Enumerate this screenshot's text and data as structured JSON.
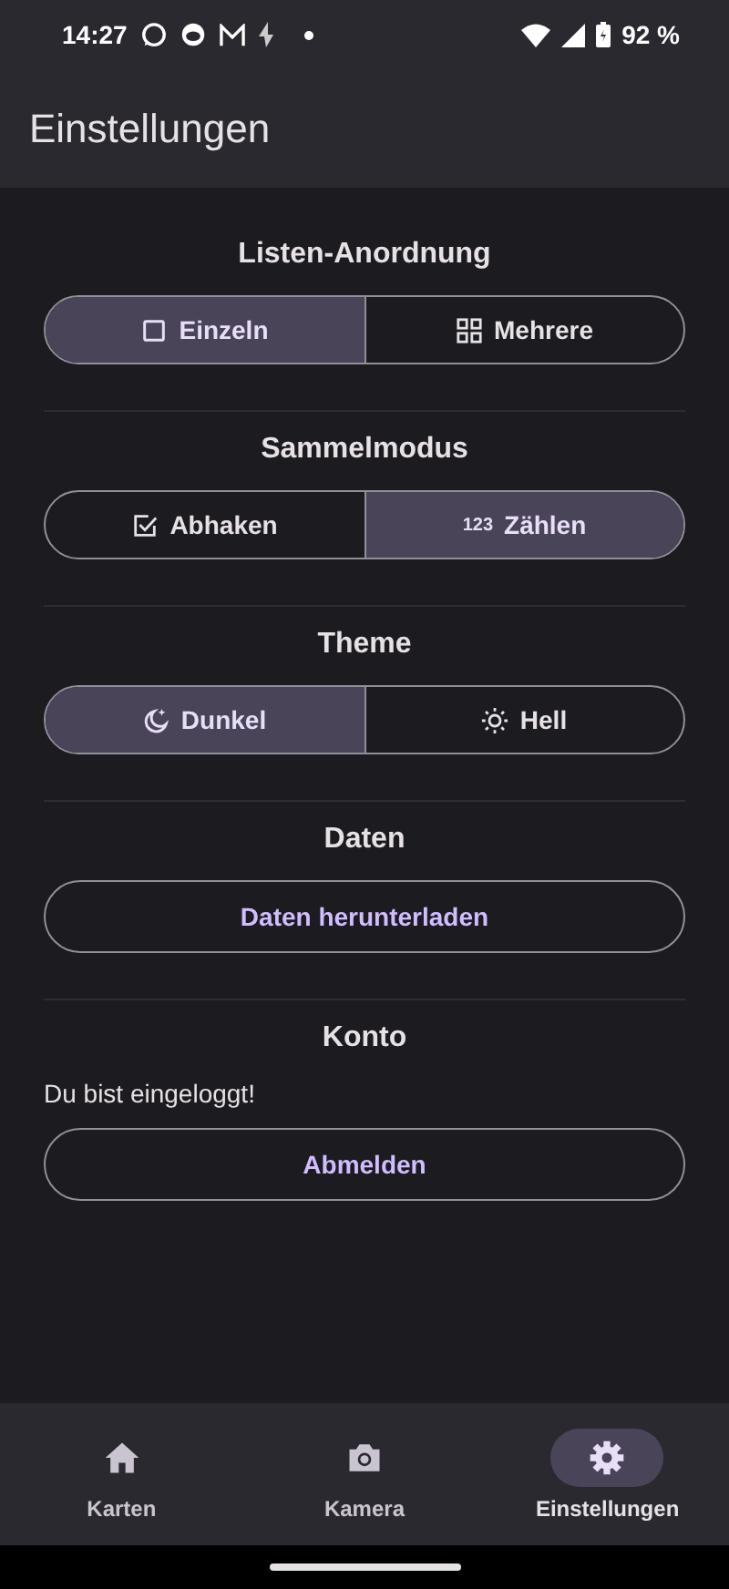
{
  "status_bar": {
    "time": "14:27",
    "battery": "92 %"
  },
  "app_bar": {
    "title": "Einstellungen"
  },
  "sections": [
    {
      "kind": "segmented",
      "title": "Listen-Anordnung",
      "options": [
        {
          "label": "Einzeln",
          "selected": true
        },
        {
          "label": "Mehrere",
          "selected": false
        }
      ]
    },
    {
      "kind": "segmented",
      "title": "Sammelmodus",
      "options": [
        {
          "label": "Abhaken",
          "selected": false
        },
        {
          "label": "Zählen",
          "glyph": "123",
          "selected": true
        }
      ]
    },
    {
      "kind": "segmented",
      "title": "Theme",
      "options": [
        {
          "label": "Dunkel",
          "selected": true
        },
        {
          "label": "Hell",
          "selected": false
        }
      ]
    },
    {
      "kind": "button",
      "title": "Daten",
      "button": "Daten herunterladen"
    },
    {
      "kind": "account",
      "title": "Konto",
      "text": "Du bist eingeloggt!",
      "button": "Abmelden"
    }
  ],
  "nav": [
    {
      "label": "Karten",
      "selected": false
    },
    {
      "label": "Kamera",
      "selected": false
    },
    {
      "label": "Einstellungen",
      "selected": true
    }
  ]
}
